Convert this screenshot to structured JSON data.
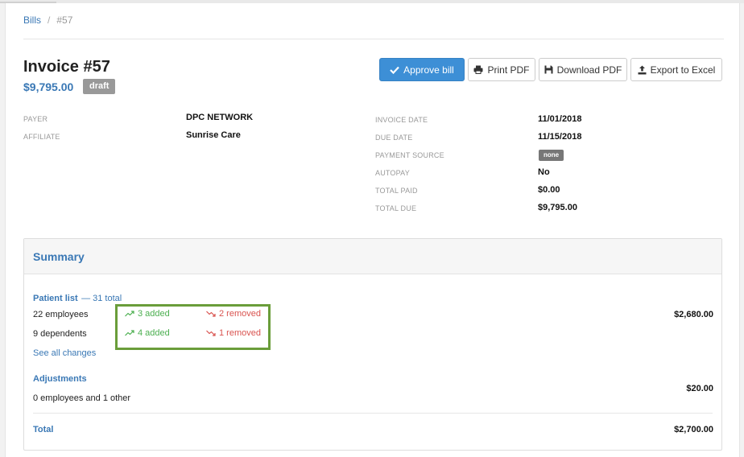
{
  "breadcrumb": {
    "root": "Bills",
    "separator": "/",
    "current": "#57"
  },
  "invoice": {
    "title": "Invoice #57",
    "amount": "$9,795.00",
    "status": "draft"
  },
  "toolbar": {
    "approve_label": "Approve bill",
    "print_label": "Print PDF",
    "download_label": "Download PDF",
    "export_label": "Export to Excel",
    "primary_color": "#3d8fd6"
  },
  "details_left": [
    {
      "label": "PAYER",
      "value": "DPC NETWORK"
    },
    {
      "label": "AFFILIATE",
      "value": "Sunrise Care"
    }
  ],
  "details_right": [
    {
      "label": "INVOICE DATE",
      "value": "11/01/2018"
    },
    {
      "label": "DUE DATE",
      "value": "11/15/2018"
    },
    {
      "label": "PAYMENT SOURCE",
      "value": "none"
    },
    {
      "label": "AUTOPAY",
      "value": "No"
    },
    {
      "label": "TOTAL PAID",
      "value": "$0.00"
    },
    {
      "label": "TOTAL DUE",
      "value": "$9,795.00"
    }
  ],
  "summary": {
    "title": "Summary",
    "patient_list": {
      "label": "Patient list",
      "total": "— 31 total",
      "employees": {
        "label": "22 employees",
        "added": "3 added",
        "removed": "2 removed"
      },
      "dependents": {
        "label": "9 dependents",
        "added": "4 added",
        "removed": "1 removed"
      },
      "amount": "$2,680.00",
      "see_all": "See all changes"
    },
    "adjustments": {
      "label": "Adjustments",
      "detail": "0 employees and 1 other",
      "amount": "$20.00"
    },
    "total": {
      "label": "Total",
      "amount": "$2,700.00"
    },
    "colors": {
      "added": "#4caf50",
      "removed": "#d9534f",
      "highlight": "#6a9d3a"
    }
  }
}
